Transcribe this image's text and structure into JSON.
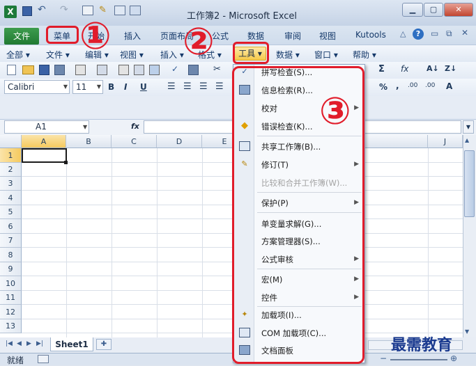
{
  "window": {
    "title": "工作簿2 - Microsoft Excel"
  },
  "ribbon_tabs": [
    "文件",
    "菜单",
    "开始",
    "插入",
    "页面布局",
    "公式",
    "数据",
    "审阅",
    "视图",
    "Kutools"
  ],
  "menubar": [
    "全部 ▾",
    "文件 ▾",
    "编辑 ▾",
    "视图 ▾",
    "插入 ▾",
    "格式 ▾",
    "工具 ▾",
    "数据 ▾",
    "窗口 ▾",
    "帮助 ▾"
  ],
  "font": {
    "name": "Calibri",
    "size": "11"
  },
  "formula": {
    "cell_ref": "A1",
    "fx": "fx"
  },
  "columns": [
    "A",
    "B",
    "C",
    "D",
    "E",
    "J"
  ],
  "rows": [
    "1",
    "2",
    "3",
    "4",
    "5",
    "6",
    "7",
    "8",
    "9",
    "10",
    "11",
    "12",
    "13"
  ],
  "sheet_tab": "Sheet1",
  "status": "就绪",
  "watermark": "最需教育",
  "annotations": [
    "①",
    "②",
    "③"
  ],
  "tools_menu": {
    "items": [
      {
        "label": "拼写检查(S)...",
        "icon": "spellcheck-icon",
        "submenu": false,
        "disabled": false
      },
      {
        "label": "信息检索(R)...",
        "icon": "research-icon",
        "submenu": false,
        "disabled": false
      },
      {
        "label": "校对",
        "icon": "",
        "submenu": true,
        "disabled": false
      },
      {
        "label": "错误检查(K)...",
        "icon": "error-check-icon",
        "submenu": false,
        "disabled": false
      },
      {
        "label": "共享工作簿(B)...",
        "icon": "share-workbook-icon",
        "submenu": false,
        "disabled": false
      },
      {
        "label": "修订(T)",
        "icon": "track-changes-icon",
        "submenu": true,
        "disabled": false
      },
      {
        "label": "比较和合并工作簿(W)...",
        "icon": "",
        "submenu": false,
        "disabled": true
      },
      {
        "label": "保护(P)",
        "icon": "",
        "submenu": true,
        "disabled": false
      },
      {
        "label": "单变量求解(G)...",
        "icon": "",
        "submenu": false,
        "disabled": false
      },
      {
        "label": "方案管理器(S)...",
        "icon": "",
        "submenu": false,
        "disabled": false
      },
      {
        "label": "公式审核",
        "icon": "",
        "submenu": true,
        "disabled": false
      },
      {
        "label": "宏(M)",
        "icon": "",
        "submenu": true,
        "disabled": false
      },
      {
        "label": "控件",
        "icon": "",
        "submenu": true,
        "disabled": false
      },
      {
        "label": "加载项(I)...",
        "icon": "addins-icon",
        "submenu": false,
        "disabled": false
      },
      {
        "label": "COM 加载项(C)...",
        "icon": "com-addins-icon",
        "submenu": false,
        "disabled": false
      },
      {
        "label": "文档面板",
        "icon": "document-panel-icon",
        "submenu": false,
        "disabled": false
      }
    ]
  }
}
